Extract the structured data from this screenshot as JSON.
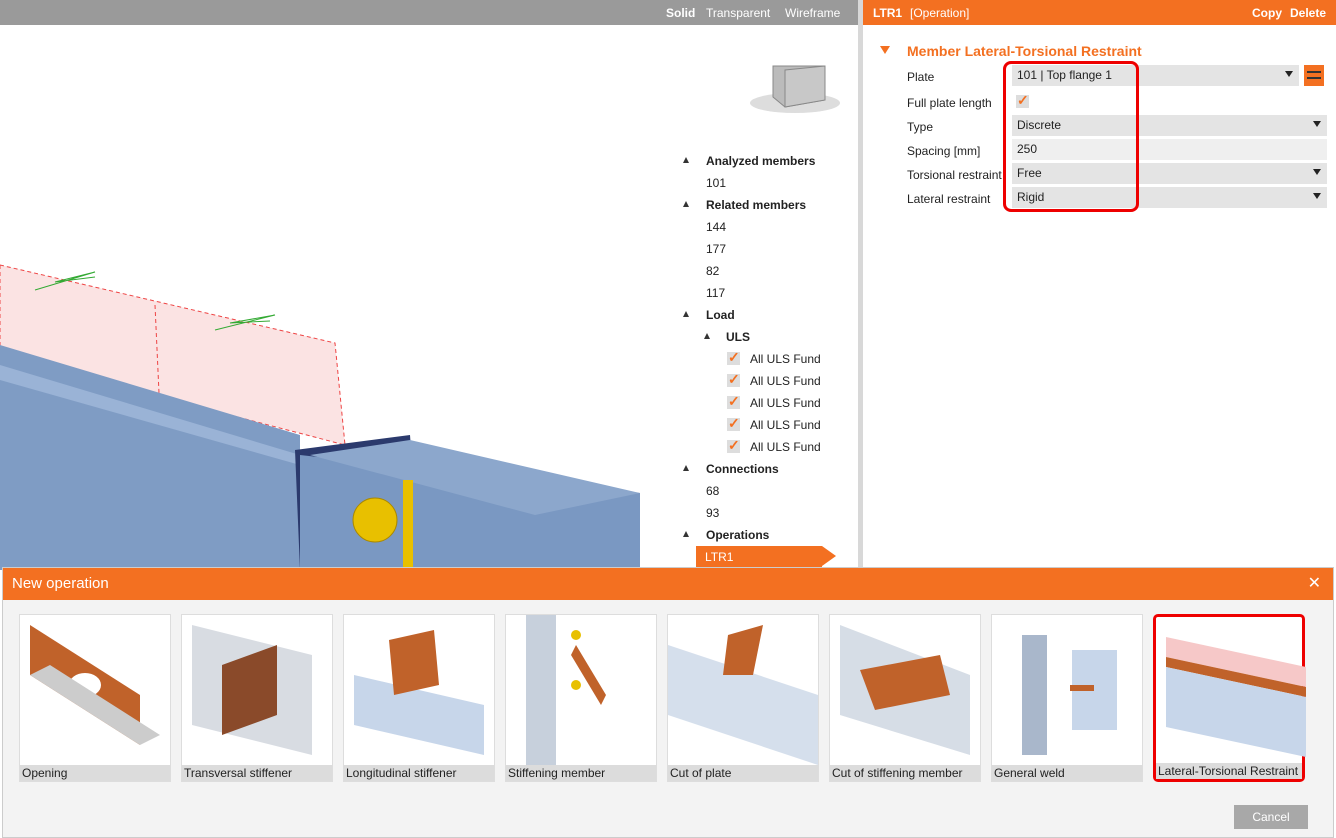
{
  "viewbar": {
    "solid": "Solid",
    "transparent": "Transparent",
    "wireframe": "Wireframe"
  },
  "panel": {
    "title": "LTR1",
    "subtitle": "[Operation]",
    "copy": "Copy",
    "delete": "Delete",
    "section": "Member Lateral-Torsional Restraint",
    "fields": [
      {
        "label": "Plate",
        "value": "101 | Top flange 1"
      },
      {
        "label": "Full plate length",
        "checked": true
      },
      {
        "label": "Type",
        "value": "Discrete"
      },
      {
        "label": "Spacing [mm]",
        "value": "250"
      },
      {
        "label": "Torsional restraint",
        "value": "Free"
      },
      {
        "label": "Lateral restraint",
        "value": "Rigid"
      }
    ]
  },
  "tree": {
    "analyzed": "Analyzed members",
    "analyzed_items": [
      "101"
    ],
    "related": "Related members",
    "related_items": [
      "144",
      "177",
      "82",
      "117"
    ],
    "load": "Load",
    "uls": "ULS",
    "uls_items": [
      "All ULS Fund",
      "All ULS Fund",
      "All ULS Fund",
      "All ULS Fund",
      "All ULS Fund"
    ],
    "connections": "Connections",
    "connection_items": [
      "68",
      "93"
    ],
    "operations": "Operations",
    "operation_items": [
      "LTR1"
    ]
  },
  "dialog": {
    "title": "New operation",
    "cancel": "Cancel",
    "items": [
      "Opening",
      "Transversal stiffener",
      "Longitudinal stiffener",
      "Stiffening member",
      "Cut of plate",
      "Cut of stiffening member",
      "General weld",
      "Lateral-Torsional Restraint"
    ],
    "selected": "Lateral-Torsional Restraint"
  },
  "colors": {
    "accent": "#f37021",
    "highlight": "#e00000",
    "steel": "#7f9cc4"
  }
}
